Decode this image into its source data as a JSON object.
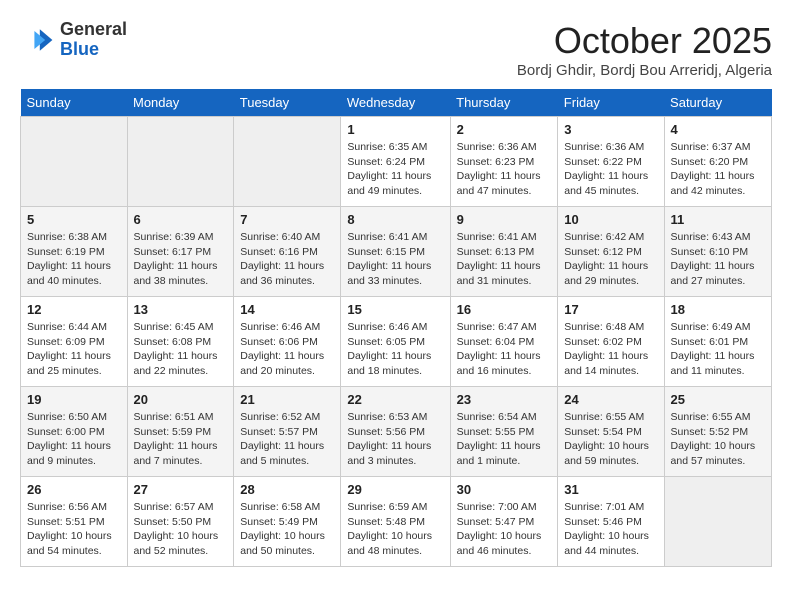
{
  "header": {
    "logo_line1": "General",
    "logo_line2": "Blue",
    "month_title": "October 2025",
    "subtitle": "Bordj Ghdir, Bordj Bou Arreridj, Algeria"
  },
  "weekdays": [
    "Sunday",
    "Monday",
    "Tuesday",
    "Wednesday",
    "Thursday",
    "Friday",
    "Saturday"
  ],
  "weeks": [
    [
      {
        "day": "",
        "info": ""
      },
      {
        "day": "",
        "info": ""
      },
      {
        "day": "",
        "info": ""
      },
      {
        "day": "1",
        "info": "Sunrise: 6:35 AM\nSunset: 6:24 PM\nDaylight: 11 hours and 49 minutes."
      },
      {
        "day": "2",
        "info": "Sunrise: 6:36 AM\nSunset: 6:23 PM\nDaylight: 11 hours and 47 minutes."
      },
      {
        "day": "3",
        "info": "Sunrise: 6:36 AM\nSunset: 6:22 PM\nDaylight: 11 hours and 45 minutes."
      },
      {
        "day": "4",
        "info": "Sunrise: 6:37 AM\nSunset: 6:20 PM\nDaylight: 11 hours and 42 minutes."
      }
    ],
    [
      {
        "day": "5",
        "info": "Sunrise: 6:38 AM\nSunset: 6:19 PM\nDaylight: 11 hours and 40 minutes."
      },
      {
        "day": "6",
        "info": "Sunrise: 6:39 AM\nSunset: 6:17 PM\nDaylight: 11 hours and 38 minutes."
      },
      {
        "day": "7",
        "info": "Sunrise: 6:40 AM\nSunset: 6:16 PM\nDaylight: 11 hours and 36 minutes."
      },
      {
        "day": "8",
        "info": "Sunrise: 6:41 AM\nSunset: 6:15 PM\nDaylight: 11 hours and 33 minutes."
      },
      {
        "day": "9",
        "info": "Sunrise: 6:41 AM\nSunset: 6:13 PM\nDaylight: 11 hours and 31 minutes."
      },
      {
        "day": "10",
        "info": "Sunrise: 6:42 AM\nSunset: 6:12 PM\nDaylight: 11 hours and 29 minutes."
      },
      {
        "day": "11",
        "info": "Sunrise: 6:43 AM\nSunset: 6:10 PM\nDaylight: 11 hours and 27 minutes."
      }
    ],
    [
      {
        "day": "12",
        "info": "Sunrise: 6:44 AM\nSunset: 6:09 PM\nDaylight: 11 hours and 25 minutes."
      },
      {
        "day": "13",
        "info": "Sunrise: 6:45 AM\nSunset: 6:08 PM\nDaylight: 11 hours and 22 minutes."
      },
      {
        "day": "14",
        "info": "Sunrise: 6:46 AM\nSunset: 6:06 PM\nDaylight: 11 hours and 20 minutes."
      },
      {
        "day": "15",
        "info": "Sunrise: 6:46 AM\nSunset: 6:05 PM\nDaylight: 11 hours and 18 minutes."
      },
      {
        "day": "16",
        "info": "Sunrise: 6:47 AM\nSunset: 6:04 PM\nDaylight: 11 hours and 16 minutes."
      },
      {
        "day": "17",
        "info": "Sunrise: 6:48 AM\nSunset: 6:02 PM\nDaylight: 11 hours and 14 minutes."
      },
      {
        "day": "18",
        "info": "Sunrise: 6:49 AM\nSunset: 6:01 PM\nDaylight: 11 hours and 11 minutes."
      }
    ],
    [
      {
        "day": "19",
        "info": "Sunrise: 6:50 AM\nSunset: 6:00 PM\nDaylight: 11 hours and 9 minutes."
      },
      {
        "day": "20",
        "info": "Sunrise: 6:51 AM\nSunset: 5:59 PM\nDaylight: 11 hours and 7 minutes."
      },
      {
        "day": "21",
        "info": "Sunrise: 6:52 AM\nSunset: 5:57 PM\nDaylight: 11 hours and 5 minutes."
      },
      {
        "day": "22",
        "info": "Sunrise: 6:53 AM\nSunset: 5:56 PM\nDaylight: 11 hours and 3 minutes."
      },
      {
        "day": "23",
        "info": "Sunrise: 6:54 AM\nSunset: 5:55 PM\nDaylight: 11 hours and 1 minute."
      },
      {
        "day": "24",
        "info": "Sunrise: 6:55 AM\nSunset: 5:54 PM\nDaylight: 10 hours and 59 minutes."
      },
      {
        "day": "25",
        "info": "Sunrise: 6:55 AM\nSunset: 5:52 PM\nDaylight: 10 hours and 57 minutes."
      }
    ],
    [
      {
        "day": "26",
        "info": "Sunrise: 6:56 AM\nSunset: 5:51 PM\nDaylight: 10 hours and 54 minutes."
      },
      {
        "day": "27",
        "info": "Sunrise: 6:57 AM\nSunset: 5:50 PM\nDaylight: 10 hours and 52 minutes."
      },
      {
        "day": "28",
        "info": "Sunrise: 6:58 AM\nSunset: 5:49 PM\nDaylight: 10 hours and 50 minutes."
      },
      {
        "day": "29",
        "info": "Sunrise: 6:59 AM\nSunset: 5:48 PM\nDaylight: 10 hours and 48 minutes."
      },
      {
        "day": "30",
        "info": "Sunrise: 7:00 AM\nSunset: 5:47 PM\nDaylight: 10 hours and 46 minutes."
      },
      {
        "day": "31",
        "info": "Sunrise: 7:01 AM\nSunset: 5:46 PM\nDaylight: 10 hours and 44 minutes."
      },
      {
        "day": "",
        "info": ""
      }
    ]
  ]
}
